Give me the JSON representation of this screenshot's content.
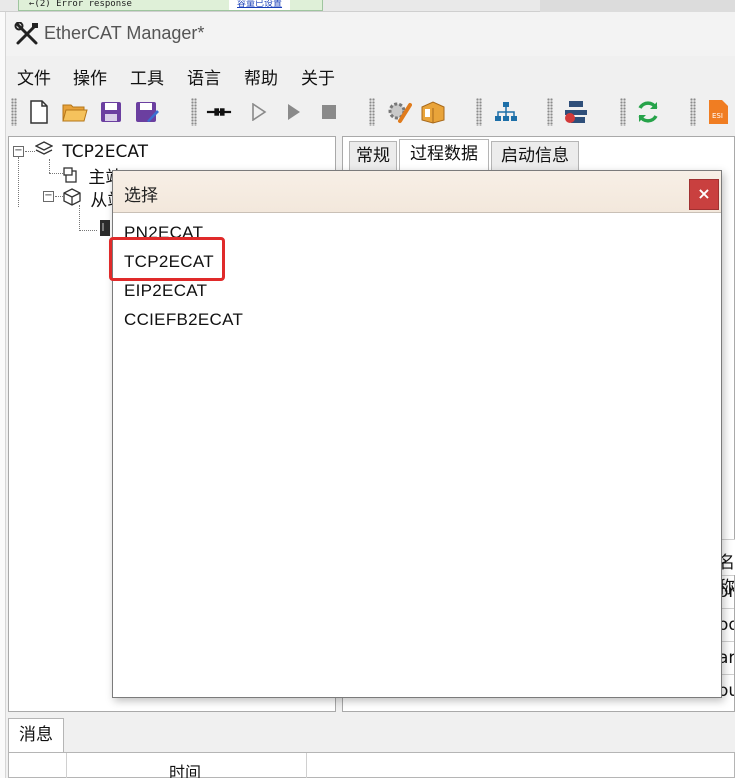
{
  "background": {
    "note_text": "←(2)    Error response",
    "note_link": "容量已设置"
  },
  "window": {
    "title": "EtherCAT Manager*",
    "icon": "tools-icon"
  },
  "menu": [
    "文件",
    "操作",
    "工具",
    "语言",
    "帮助",
    "关于"
  ],
  "toolbar": {
    "icons": [
      "new-file-icon",
      "open-folder-icon",
      "save-icon",
      "save-as-icon",
      "connect-icon",
      "run-icon",
      "play-icon",
      "stop-icon",
      "config-icon",
      "package-icon",
      "network-icon",
      "device-icon",
      "refresh-icon",
      "esi-icon"
    ],
    "esi_label": "ESI"
  },
  "tree": {
    "root": "TCP2ECAT",
    "master": "主站",
    "slave": "从站"
  },
  "right_pane": {
    "tabs": [
      "常规",
      "过程数据",
      "启动信息"
    ],
    "partial_header": "名称",
    "partial_rows": [
      "on",
      "od",
      "arg",
      "ou"
    ]
  },
  "messages": {
    "tab": "消息",
    "column_time": "时间"
  },
  "dialog": {
    "title": "选择",
    "close": "×",
    "options": [
      "PN2ECAT",
      "TCP2ECAT",
      "EIP2ECAT",
      "CCIEFB2ECAT"
    ],
    "highlighted_option": "TCP2ECAT",
    "highlight_color": "#e02a2a"
  }
}
